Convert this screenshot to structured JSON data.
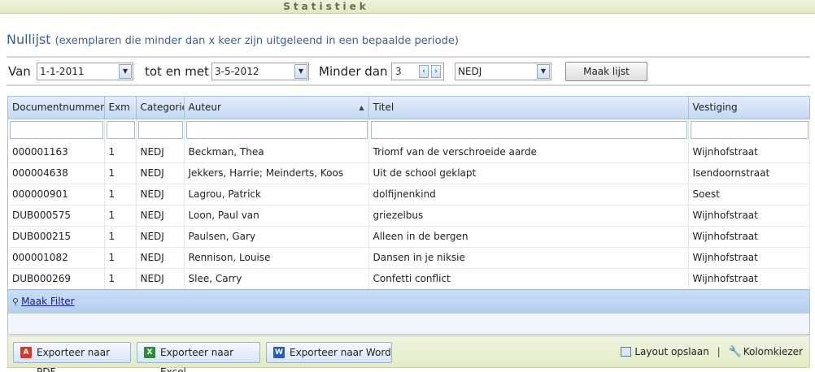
{
  "window": {
    "title": "Statistiek"
  },
  "heading": {
    "title": "Nullijst",
    "subtitle": "(exemplaren die minder dan x keer zijn uitgeleend in een bepaalde periode)"
  },
  "params": {
    "from_label": "Van",
    "from_value": "1-1-2011",
    "to_label": "tot en met",
    "to_value": "3-5-2012",
    "less_label": "Minder dan",
    "less_value": "3",
    "category_value": "NEDJ",
    "make_button": "Maak lijst"
  },
  "grid": {
    "columns": [
      "Documentnummer",
      "Exm",
      "Categorie",
      "Auteur",
      "Titel",
      "Vestiging"
    ],
    "sorted_column": "Auteur",
    "rows": [
      [
        "000001163",
        "1",
        "NEDJ",
        "Beckman, Thea",
        "Triomf van de verschroeide aarde",
        "Wijnhofstraat"
      ],
      [
        "000004638",
        "1",
        "NEDJ",
        "Jekkers, Harrie; Meinderts, Koos",
        "Uit de school geklapt",
        "Isendoornstraat"
      ],
      [
        "000000901",
        "1",
        "NEDJ",
        "Lagrou, Patrick",
        "dolfijnenkind",
        "Soest"
      ],
      [
        "DUB000575",
        "1",
        "NEDJ",
        "Loon, Paul van",
        "griezelbus",
        "Wijnhofstraat"
      ],
      [
        "DUB000215",
        "1",
        "NEDJ",
        "Paulsen, Gary",
        "Alleen in de bergen",
        "Wijnhofstraat"
      ],
      [
        "000001082",
        "1",
        "NEDJ",
        "Rennison, Louise",
        "Dansen in je niksie",
        "Wijnhofstraat"
      ],
      [
        "DUB000269",
        "1",
        "NEDJ",
        "Slee, Carry",
        "Confetti conflict",
        "Wijnhofstraat"
      ]
    ],
    "filter_link": "Maak Filter"
  },
  "footer": {
    "export_pdf": "Exporteer naar PDF",
    "export_excel": "Exporteer naar Excel",
    "export_word": "Exporteer naar Word",
    "layout_save": "Layout opslaan",
    "column_chooser": "Kolomkiezer"
  },
  "icons": {
    "pdf": "pdf-icon",
    "excel": "excel-icon",
    "word": "word-icon",
    "layout": "layout-icon",
    "columns": "wrench-icon",
    "filter": "filter-icon"
  },
  "colors": {
    "heading": "#3b5f9e",
    "header_bar": "#dfe8c2",
    "grid_header": "#c4d9f3"
  }
}
